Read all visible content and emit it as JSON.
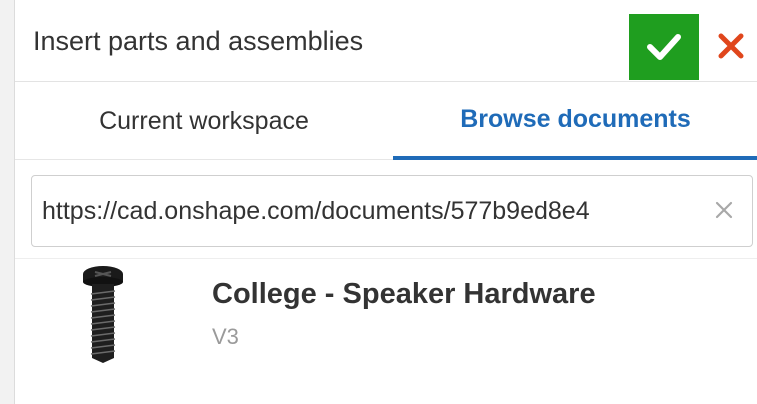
{
  "dialog": {
    "title": "Insert parts and assemblies"
  },
  "tabs": [
    {
      "label": "Current workspace",
      "active": false
    },
    {
      "label": "Browse documents",
      "active": true
    }
  ],
  "search": {
    "value": "https://cad.onshape.com/documents/577b9ed8e4",
    "placeholder": ""
  },
  "results": [
    {
      "name": "College - Speaker Hardware",
      "version": "V3",
      "thumbnail_icon": "screw-icon"
    }
  ],
  "colors": {
    "accept": "#1f9e1f",
    "cancel": "#e0461c",
    "active_tab": "#1f6bb8"
  },
  "icons": {
    "accept": "checkmark-icon",
    "cancel": "close-icon",
    "clear": "clear-icon"
  }
}
